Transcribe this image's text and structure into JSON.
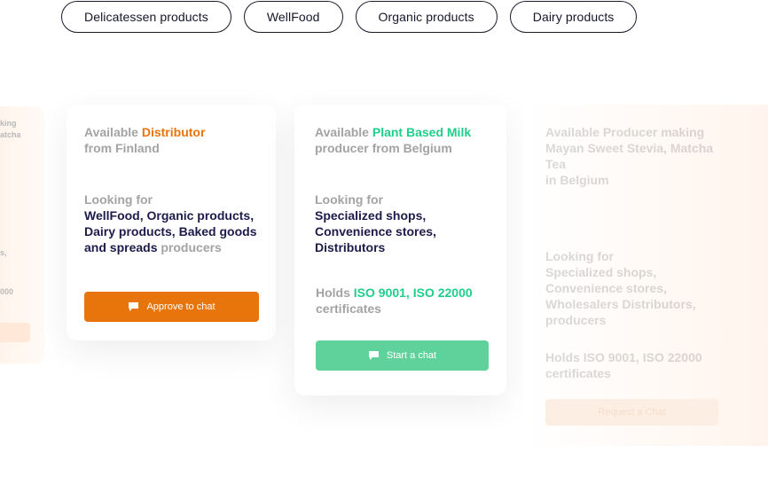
{
  "tags": [
    "Delicatessen products",
    "WellFood",
    "Organic products",
    "Dairy products"
  ],
  "left_card": {
    "line1": "king",
    "line2": "atcha",
    "line3": "s,",
    "line4": "000"
  },
  "card1": {
    "available": "Available ",
    "highlight": "Distributor",
    "origin": "from Finland",
    "looking_label": "Looking for",
    "looking_items": "WellFood, Organic products, Dairy products, Baked goods and spreads",
    "looking_suffix": " producers",
    "button": "Approve to chat"
  },
  "card2": {
    "available": "Available ",
    "highlight": "Plant Based Milk",
    "origin": "producer from Belgium",
    "looking_label": "Looking for",
    "looking_items": "Specialized shops, Convenience stores, Distributors",
    "holds_label": "Holds ",
    "certs": "ISO 9001, ISO 22000",
    "certs_suffix": "certificates",
    "button": "Start a chat"
  },
  "card3": {
    "available": "Available Producer making Mayan Sweet Stevia, Matcha Tea",
    "origin": "in Belgium",
    "looking_label": "Looking for",
    "looking_items": "Specialized shops, Convenience stores, Wholesalers Distributors,",
    "looking_suffix": "producers",
    "holds": "Holds ISO 9001, ISO 22000",
    "certs_suffix": "certificates",
    "button": "Request a Chat"
  },
  "colors": {
    "accent_orange": "#e8740c",
    "accent_green": "#1fce8a",
    "button_green": "#5ed29a",
    "navy": "#1d1b4a",
    "grey": "#a3a3a3"
  }
}
